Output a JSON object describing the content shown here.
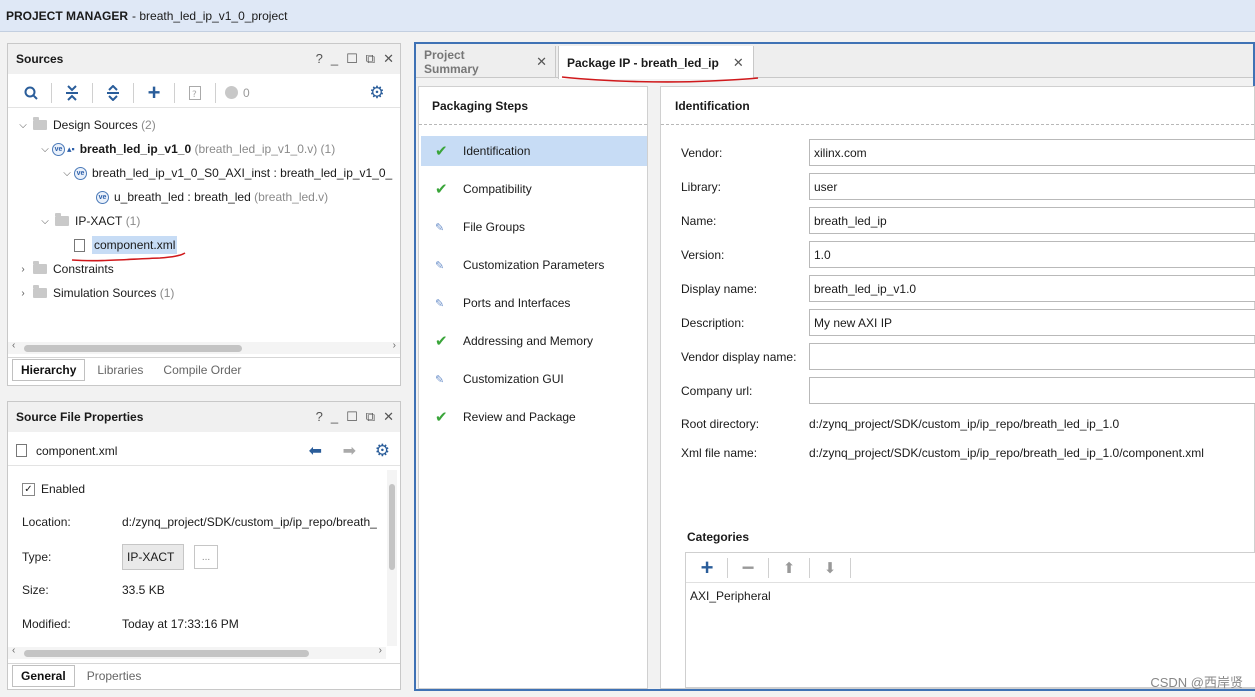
{
  "window": {
    "title_bold": "PROJECT MANAGER",
    "title_rest": "- breath_led_ip_v1_0_project"
  },
  "sources": {
    "title": "Sources",
    "count_badge": "0",
    "tree": [
      {
        "label": "Design Sources",
        "suffix": "(2)"
      },
      {
        "label": "breath_led_ip_v1_0",
        "suffix": "(breath_led_ip_v1_0.v) (1)"
      },
      {
        "label": "breath_led_ip_v1_0_S0_AXI_inst : breath_led_ip_v1_0_",
        "suffix": ""
      },
      {
        "label": "u_breath_led : breath_led",
        "suffix": "(breath_led.v)"
      },
      {
        "label": "IP-XACT",
        "suffix": "(1)"
      },
      {
        "label": "component.xml",
        "suffix": ""
      },
      {
        "label": "Constraints",
        "suffix": ""
      },
      {
        "label": "Simulation Sources",
        "suffix": "(1)"
      }
    ],
    "tabs": [
      "Hierarchy",
      "Libraries",
      "Compile Order"
    ]
  },
  "file_props": {
    "title": "Source File Properties",
    "file_name": "component.xml",
    "enabled_label": "Enabled",
    "location_label": "Location:",
    "location_value": "d:/zynq_project/SDK/custom_ip/ip_repo/breath_",
    "type_label": "Type:",
    "type_value": "IP-XACT",
    "type_button": "...",
    "size_label": "Size:",
    "size_value": "33.5 KB",
    "modified_label": "Modified:",
    "modified_value": "Today at 17:33:16 PM",
    "tabs": [
      "General",
      "Properties"
    ]
  },
  "main_tabs": [
    "Project Summary",
    "Package IP - breath_led_ip"
  ],
  "packaging_steps": {
    "title": "Packaging Steps",
    "steps": [
      {
        "label": "Identification",
        "status": "check"
      },
      {
        "label": "Compatibility",
        "status": "check"
      },
      {
        "label": "File Groups",
        "status": "edit"
      },
      {
        "label": "Customization Parameters",
        "status": "edit"
      },
      {
        "label": "Ports and Interfaces",
        "status": "edit"
      },
      {
        "label": "Addressing and Memory",
        "status": "check"
      },
      {
        "label": "Customization GUI",
        "status": "edit"
      },
      {
        "label": "Review and Package",
        "status": "check"
      }
    ]
  },
  "identification": {
    "title": "Identification",
    "vendor_label": "Vendor:",
    "vendor": "xilinx.com",
    "library_label": "Library:",
    "library": "user",
    "name_label": "Name:",
    "name": "breath_led_ip",
    "version_label": "Version:",
    "version": "1.0",
    "display_name_label": "Display name:",
    "display_name": "breath_led_ip_v1.0",
    "description_label": "Description:",
    "description": "My new AXI IP",
    "vendor_display_label": "Vendor display name:",
    "vendor_display": "",
    "company_url_label": "Company url:",
    "company_url": "",
    "root_dir_label": "Root directory:",
    "root_dir": "d:/zynq_project/SDK/custom_ip/ip_repo/breath_led_ip_1.0",
    "xml_label": "Xml file name:",
    "xml": "d:/zynq_project/SDK/custom_ip/ip_repo/breath_led_ip_1.0/component.xml",
    "categories_label": "Categories",
    "categories": [
      "AXI_Peripheral"
    ]
  },
  "watermark": "CSDN @西岸贤",
  "colors": {
    "accent": "#3f72b5",
    "selected": "#c7dcf5",
    "check": "#3aa53a",
    "annotation": "#d0191c"
  }
}
